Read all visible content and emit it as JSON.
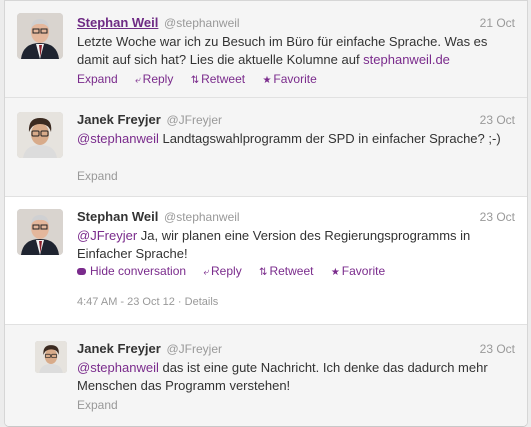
{
  "tweets": [
    {
      "fullname": "Stephan Weil",
      "username": "@stephanweil",
      "time": "21 Oct",
      "text_before": "Letzte Woche war ich zu Besuch im Büro für einfache Sprache. Was es damit auf sich hat? Lies die aktuelle Kolumne auf ",
      "link": "stephanweil.de",
      "actions": {
        "expand": "Expand",
        "reply": "Reply",
        "retweet": "Retweet",
        "favorite": "Favorite"
      }
    },
    {
      "fullname": "Janek Freyjer",
      "username": "@JFreyjer",
      "time": "23 Oct",
      "mention": "@stephanweil",
      "text_after": " Landtagswahlprogramm der SPD in einfacher Sprache? ;-)",
      "expand": "Expand"
    },
    {
      "fullname": "Stephan Weil",
      "username": "@stephanweil",
      "time": "23 Oct",
      "mention": "@JFreyjer",
      "text_after": " Ja, wir planen eine Version des Regierungsprogramms in Einfacher Sprache!",
      "actions": {
        "hide": "Hide conversation",
        "reply": "Reply",
        "retweet": "Retweet",
        "favorite": "Favorite"
      },
      "timestamp": "4:47 AM - 23 Oct 12",
      "sep": "·",
      "details": "Details"
    },
    {
      "fullname": "Janek Freyjer",
      "username": "@JFreyjer",
      "time": "23 Oct",
      "mention": "@stephanweil",
      "text_after": " das ist eine gute Nachricht. Ich denke das dadurch mehr Menschen das Programm verstehen!",
      "expand": "Expand"
    }
  ],
  "colors": {
    "link": "#7a2b8c",
    "muted": "#999999",
    "row_bg": "#f5f5f5"
  },
  "icons": [
    "reply-arrow-icon",
    "retweet-icon",
    "favorite-star-icon",
    "speech-bubble-icon"
  ]
}
